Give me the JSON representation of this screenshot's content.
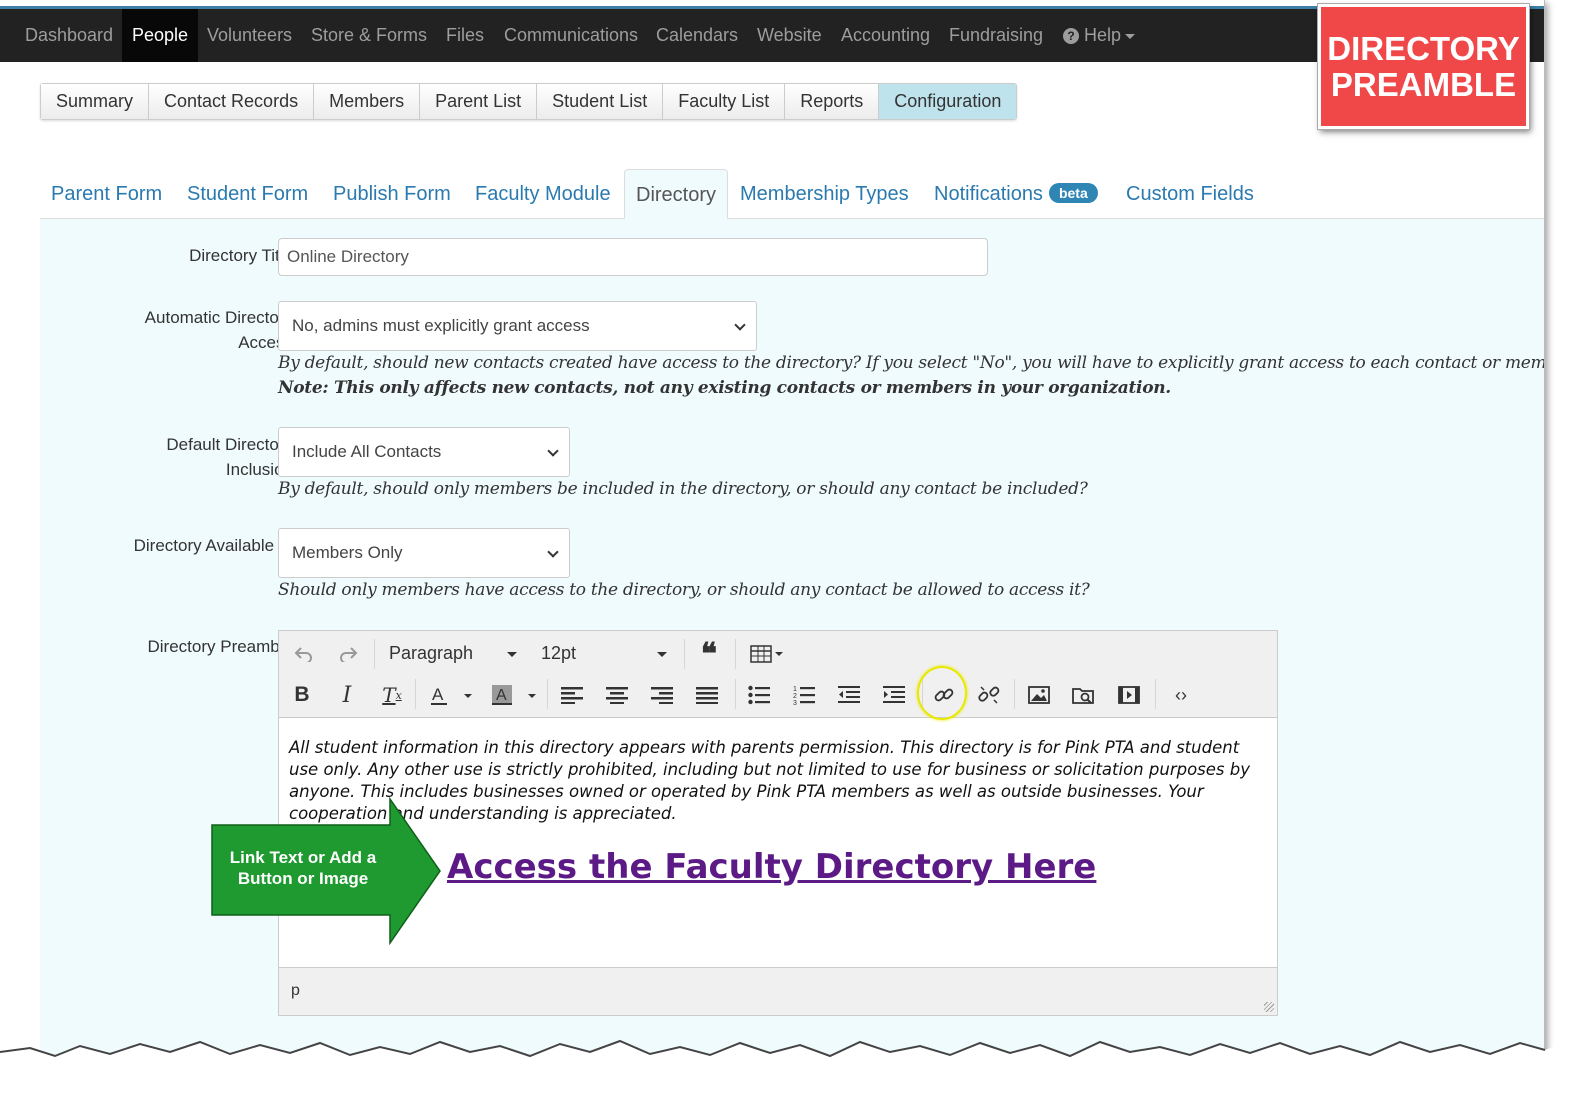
{
  "topnav": {
    "items": [
      "Dashboard",
      "People",
      "Volunteers",
      "Store & Forms",
      "Files",
      "Communications",
      "Calendars",
      "Website",
      "Accounting",
      "Fundraising"
    ],
    "help_label": "Help"
  },
  "callout": {
    "line1": "DIRECTORY",
    "line2": "PREAMBLE",
    "color": "#f04848"
  },
  "subnav": {
    "buttons": [
      "Summary",
      "Contact Records",
      "Members",
      "Parent List",
      "Student List",
      "Faculty List",
      "Reports",
      "Configuration"
    ]
  },
  "tabs": {
    "items": [
      "Parent Form",
      "Student Form",
      "Publish Form",
      "Faculty Module",
      "Directory",
      "Membership Types",
      "Notifications",
      "Custom Fields"
    ],
    "notifications_badge": "beta"
  },
  "form": {
    "directory_title": {
      "label": "Directory Title",
      "value": "Online Directory"
    },
    "auto_access": {
      "label_line1": "Automatic Directory",
      "label_line2": "Access",
      "selected": "No, admins must explicitly grant access",
      "help": "By default, should new contacts created have access to the directory? If you select \"No\", you will have to explicitly grant access to each contact or member.",
      "note": "Note: This only affects new contacts, not any existing contacts or members in your organization."
    },
    "default_inclusion": {
      "label_line1": "Default Directory",
      "label_line2": "Inclusion",
      "selected": "Include All Contacts",
      "help": "By default, should only members be included in the directory, or should any contact be included?"
    },
    "available_to": {
      "label": "Directory Available to",
      "selected": "Members Only",
      "help": "Should only members have access to the directory, or should any contact be allowed to access it?"
    },
    "preamble": {
      "label": "Directory Preamble",
      "format_select": "Paragraph",
      "size_select": "12pt",
      "content": "All student information in this directory appears with parents permission. This directory is for Pink PTA and student use only. Any other use is strictly prohibited, including but not limited to use for business or solicitation purposes by anyone. This includes businesses owned or operated by Pink PTA members as well as outside businesses. Your cooperation and understanding is appreciated.",
      "link_text": "Access the Faculty Directory Here",
      "status_path": "p"
    }
  },
  "annotation": {
    "arrow_line1": "Link Text or Add a",
    "arrow_line2": "Button or Image",
    "arrow_color": "#1e9a30"
  }
}
